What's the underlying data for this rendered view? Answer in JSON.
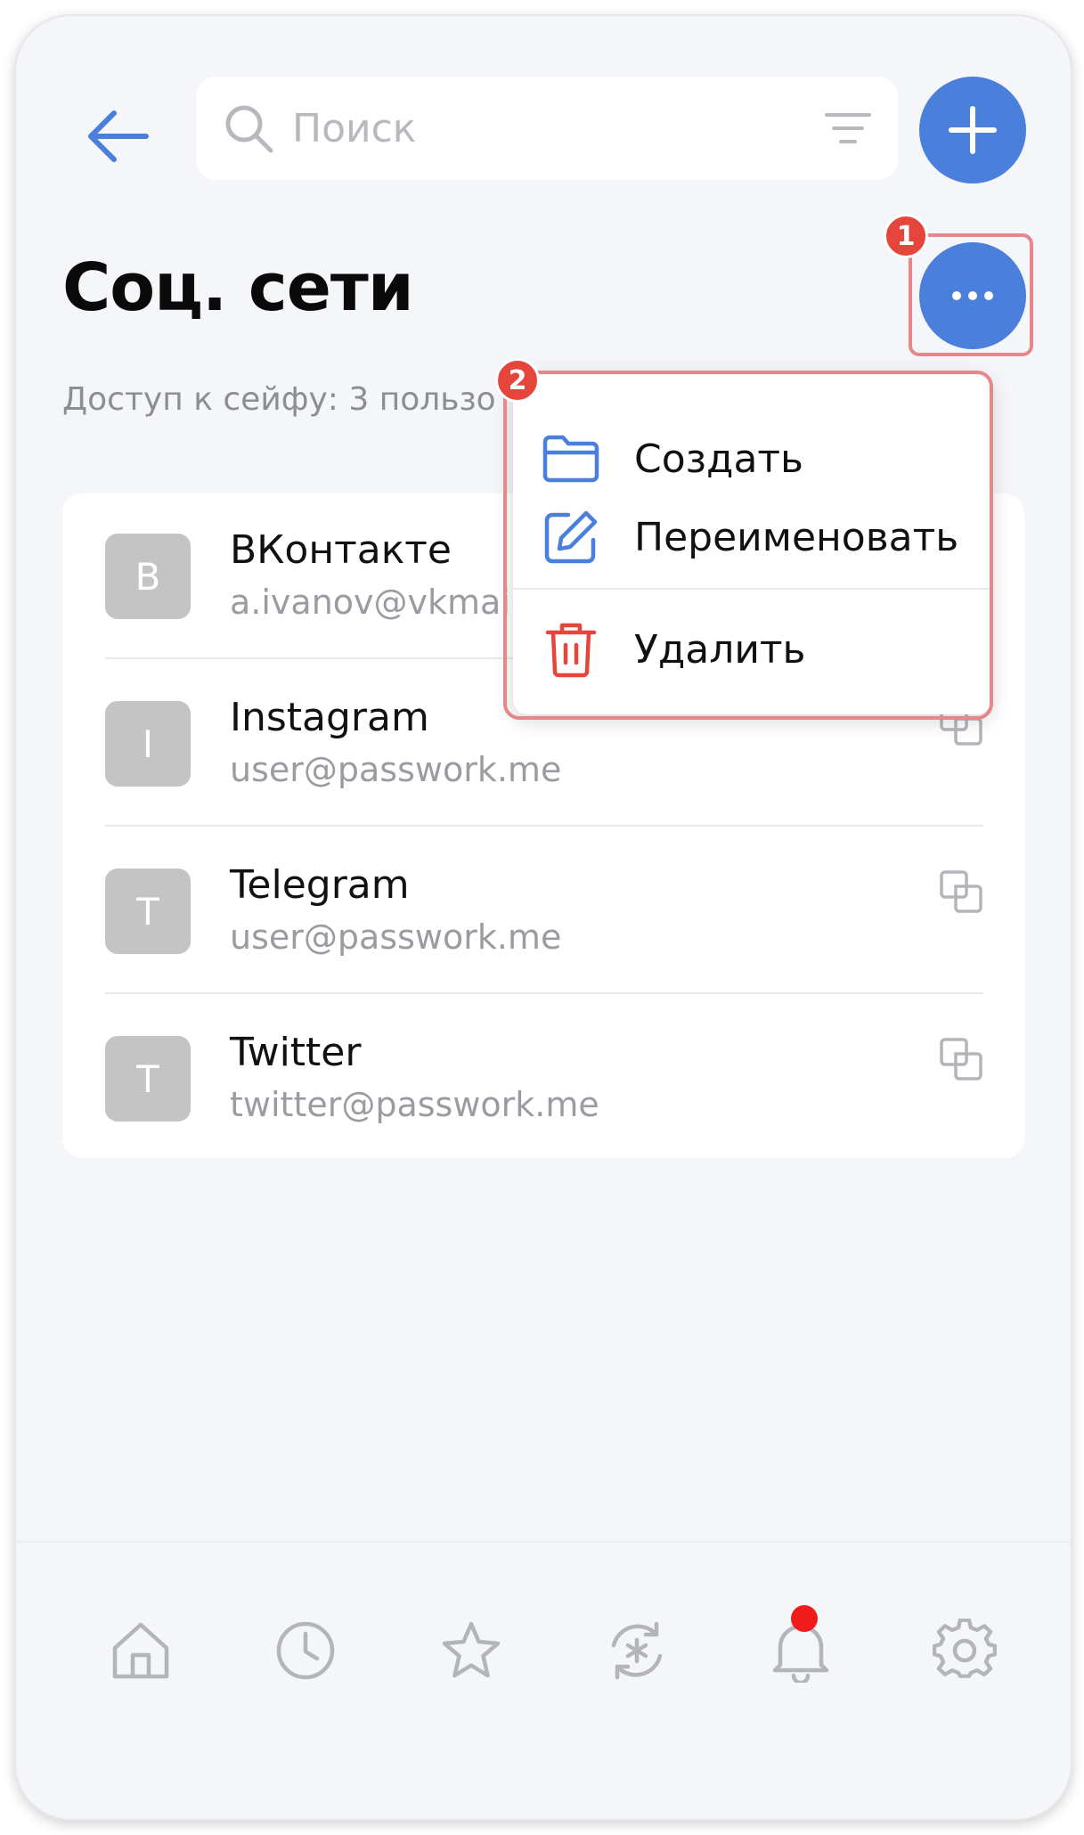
{
  "header": {
    "search_placeholder": "Поиск"
  },
  "vault": {
    "title": "Соц. сети",
    "access_text": "Доступ к сейфу: 3 пользо"
  },
  "annotations": {
    "badge_1": "1",
    "badge_2": "2"
  },
  "items": [
    {
      "avatar_letter": "B",
      "title": "ВКонтакте",
      "login": "a.ivanov@vkmai"
    },
    {
      "avatar_letter": "I",
      "title": "Instagram",
      "login": "user@passwork.me"
    },
    {
      "avatar_letter": "T",
      "title": "Telegram",
      "login": "user@passwork.me"
    },
    {
      "avatar_letter": "T",
      "title": "Twitter",
      "login": "twitter@passwork.me"
    }
  ],
  "menu": {
    "create": "Создать",
    "rename": "Переименовать",
    "delete": "Удалить"
  },
  "tabs": [
    "home-icon",
    "clock-icon",
    "star-icon",
    "password-generator-icon",
    "bell-icon",
    "gear-icon"
  ],
  "colors": {
    "accent": "#4a7fdb",
    "danger": "#e5453b",
    "highlight": "#e8868a",
    "notification": "#f01c1c"
  }
}
